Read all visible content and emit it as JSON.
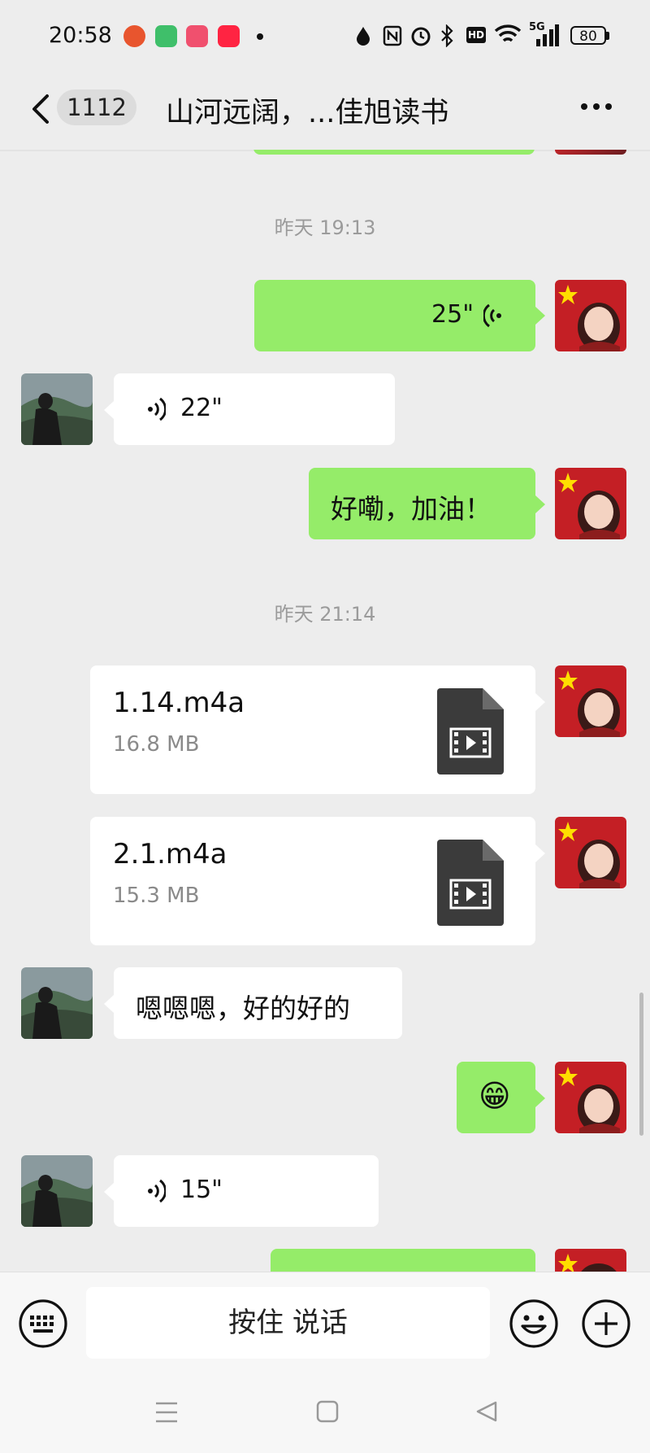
{
  "status_bar": {
    "time": "20:58",
    "network": "5G",
    "battery": "80",
    "hd": "HD"
  },
  "header": {
    "unread_count": "1112",
    "title": "山河远阔，...佳旭读书"
  },
  "timestamps": [
    "昨天 19:13",
    "昨天 21:14"
  ],
  "messages": {
    "voice_sent_1": "25\"",
    "voice_recv_1": "22\"",
    "text_sent_1": "好嘞，加油！",
    "file_1_name": "1.14.m4a",
    "file_1_size": "16.8 MB",
    "file_2_name": "2.1.m4a",
    "file_2_size": "15.3 MB",
    "text_recv_1": "嗯嗯嗯，好的好的",
    "emoji_sent": "😁",
    "voice_recv_2": "15\""
  },
  "input": {
    "hold_to_talk": "按住 说话"
  },
  "colors": {
    "sent_bubble": "#95ec69",
    "received_bubble": "#ffffff",
    "background": "#ededed"
  }
}
